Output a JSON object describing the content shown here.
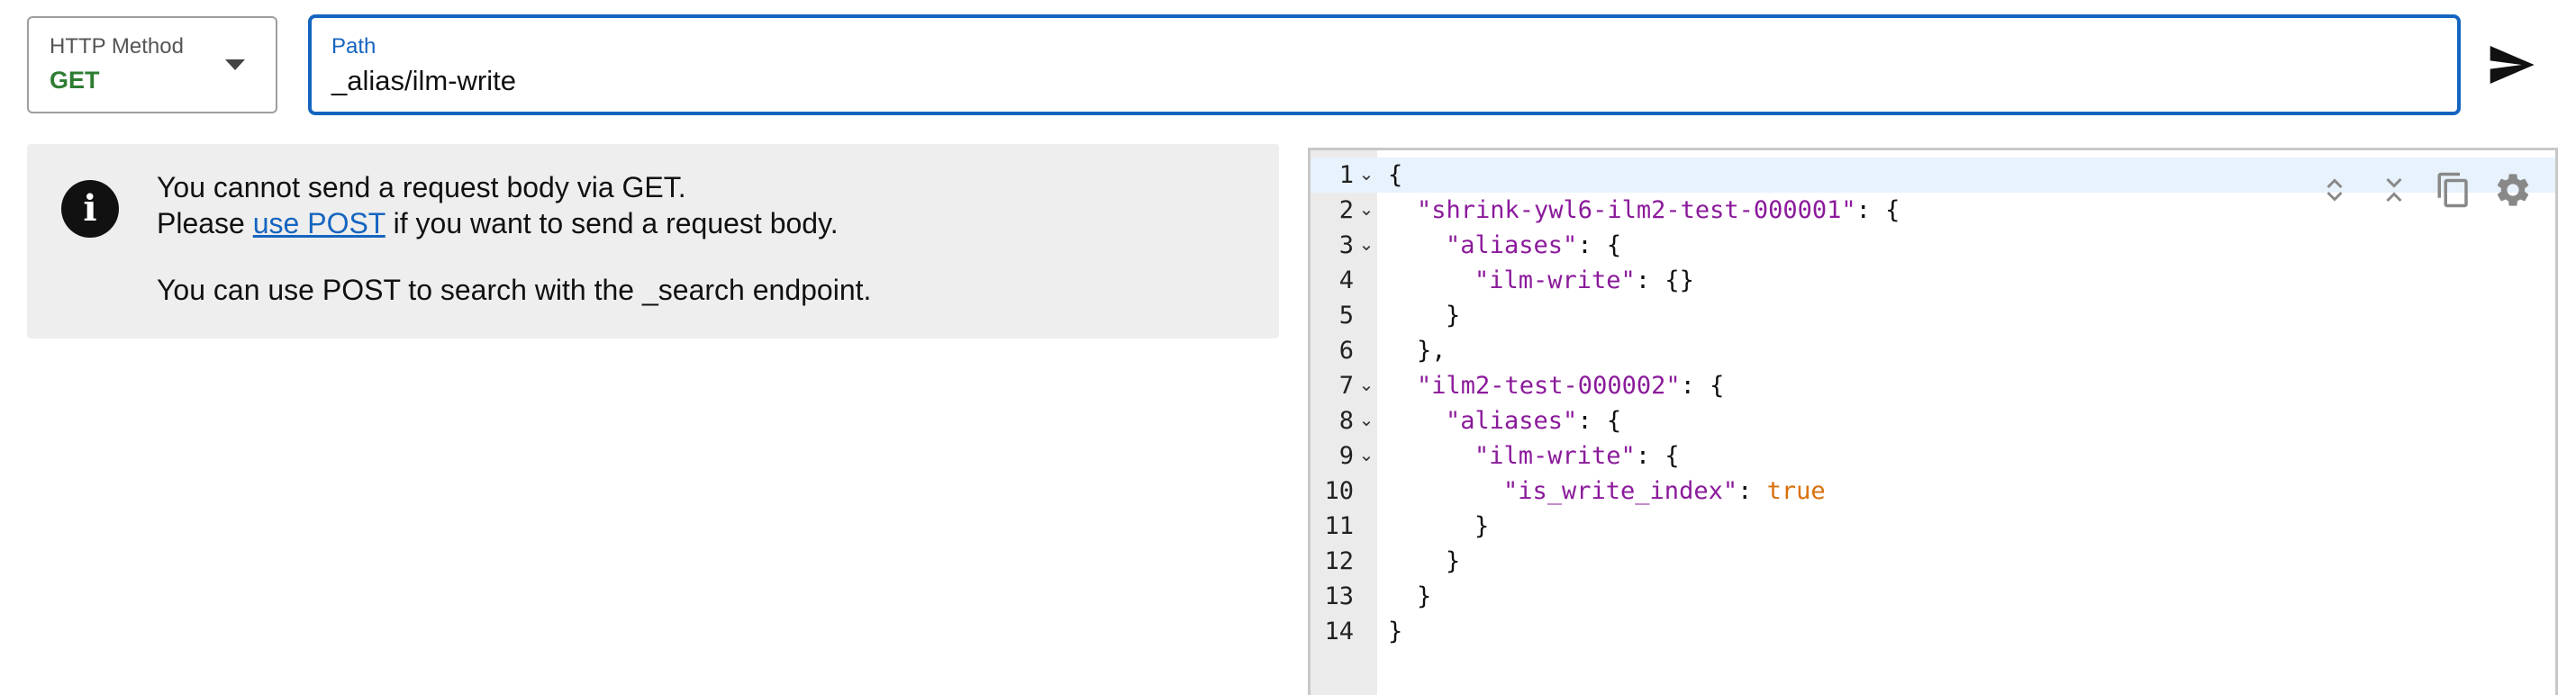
{
  "request": {
    "method_label": "HTTP Method",
    "method_value": "GET",
    "path_label": "Path",
    "path_value": "_alias/ilm-write"
  },
  "info": {
    "line1": "You cannot send a request body via GET.",
    "line2_pre": "Please ",
    "line2_link": "use POST",
    "line2_post": " if you want to send a request body.",
    "line3": "You can use POST to search with the _search endpoint."
  },
  "editor": {
    "lines": [
      {
        "n": "1",
        "fold": true
      },
      {
        "n": "2",
        "fold": true
      },
      {
        "n": "3",
        "fold": true
      },
      {
        "n": "4",
        "fold": false
      },
      {
        "n": "5",
        "fold": false
      },
      {
        "n": "6",
        "fold": false
      },
      {
        "n": "7",
        "fold": true
      },
      {
        "n": "8",
        "fold": true
      },
      {
        "n": "9",
        "fold": true
      },
      {
        "n": "10",
        "fold": false
      },
      {
        "n": "11",
        "fold": false
      },
      {
        "n": "12",
        "fold": false
      },
      {
        "n": "13",
        "fold": false
      },
      {
        "n": "14",
        "fold": false
      }
    ],
    "code": {
      "l1": "{",
      "l2_key": "\"shrink-ywl6-ilm2-test-000001\"",
      "l2_rest": ": {",
      "l3_key": "\"aliases\"",
      "l3_rest": ": {",
      "l4_key": "\"ilm-write\"",
      "l4_rest": ": {}",
      "l5": "}",
      "l6": "},",
      "l7_key": "\"ilm2-test-000002\"",
      "l7_rest": ": {",
      "l8_key": "\"aliases\"",
      "l8_rest": ": {",
      "l9_key": "\"ilm-write\"",
      "l9_rest": ": {",
      "l10_key": "\"is_write_index\"",
      "l10_sep": ": ",
      "l10_val": "true",
      "l11": "}",
      "l12": "}",
      "l13": "}",
      "l14": "}"
    },
    "fold_glyph": "⌄"
  },
  "colors": {
    "accent": "#1565c0",
    "method_get": "#2e7d32",
    "json_key": "#8b1a9b",
    "json_bool": "#d9700c"
  }
}
